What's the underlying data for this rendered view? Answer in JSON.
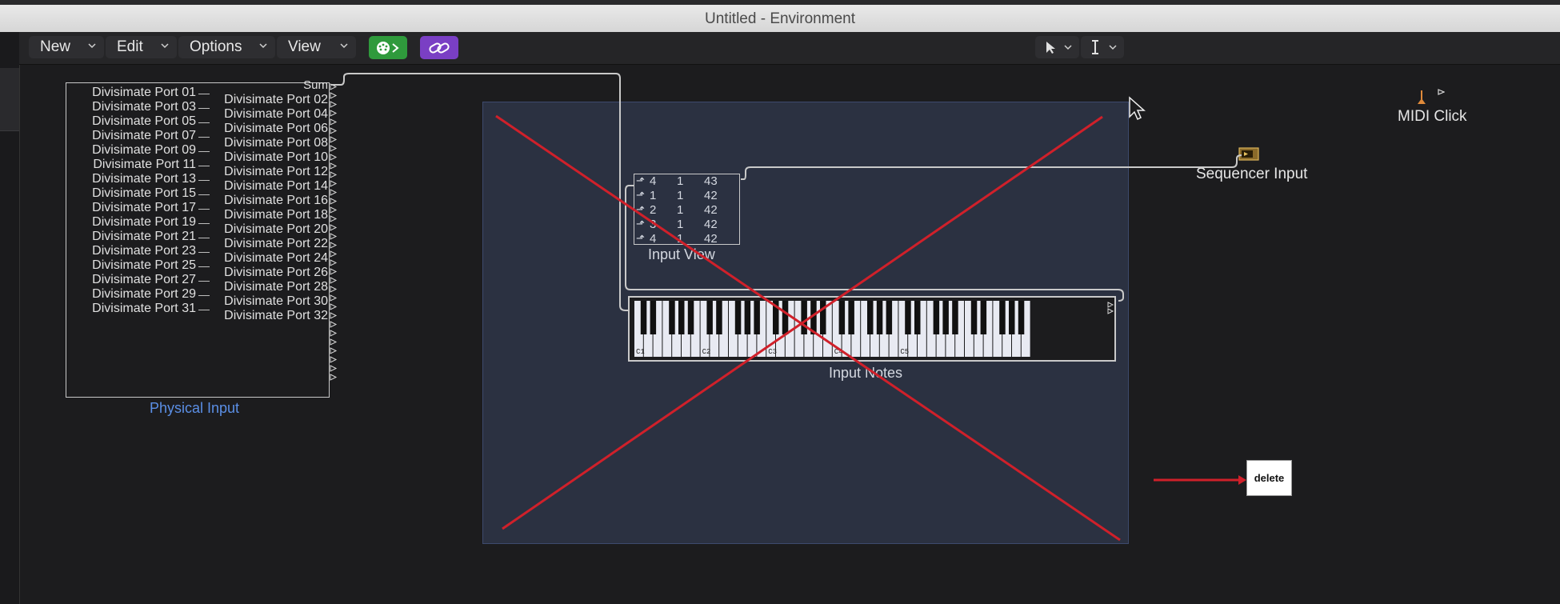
{
  "window": {
    "title": "Untitled - Environment"
  },
  "toolbar": {
    "menus": [
      "New",
      "Edit",
      "Options",
      "View"
    ],
    "midi_button_icon": "midi-connector-icon",
    "link_button_icon": "link-icon",
    "pointer_tool_icon": "pointer-icon",
    "text_tool_icon": "text-cursor-icon"
  },
  "physical_input": {
    "label": "Physical Input",
    "sum_label": "Sum",
    "left_ports": [
      "Divisimate Port 01",
      "Divisimate Port 03",
      "Divisimate Port 05",
      "Divisimate Port 07",
      "Divisimate Port 09",
      "Divisimate Port 11",
      "Divisimate Port 13",
      "Divisimate Port 15",
      "Divisimate Port 17",
      "Divisimate Port 19",
      "Divisimate Port 21",
      "Divisimate Port 23",
      "Divisimate Port 25",
      "Divisimate Port 27",
      "Divisimate Port 29",
      "Divisimate Port 31"
    ],
    "right_ports": [
      "Divisimate Port 02",
      "Divisimate Port 04",
      "Divisimate Port 06",
      "Divisimate Port 08",
      "Divisimate Port 10",
      "Divisimate Port 12",
      "Divisimate Port 14",
      "Divisimate Port 16",
      "Divisimate Port 18",
      "Divisimate Port 20",
      "Divisimate Port 22",
      "Divisimate Port 24",
      "Divisimate Port 26",
      "Divisimate Port 28",
      "Divisimate Port 30",
      "Divisimate Port 32"
    ]
  },
  "input_view": {
    "label": "Input View",
    "rows": [
      [
        "4",
        "1",
        "43"
      ],
      [
        "1",
        "1",
        "42"
      ],
      [
        "2",
        "1",
        "42"
      ],
      [
        "3",
        "1",
        "42"
      ],
      [
        "4",
        "1",
        "42"
      ]
    ]
  },
  "input_notes": {
    "label": "Input Notes",
    "octave_labels": [
      "C1",
      "C2",
      "C3",
      "C4",
      "C5"
    ]
  },
  "sequencer_input": {
    "label": "Sequencer Input"
  },
  "midi_click": {
    "label": "MIDI Click"
  },
  "annotation": {
    "delete_label": "delete"
  },
  "colors": {
    "selection_fill": "#2b3141",
    "cross_line": "#d0202a",
    "midi_button": "#2f9a3c",
    "link_button": "#7a3fc4",
    "physical_input_label": "#5b8fe6"
  }
}
